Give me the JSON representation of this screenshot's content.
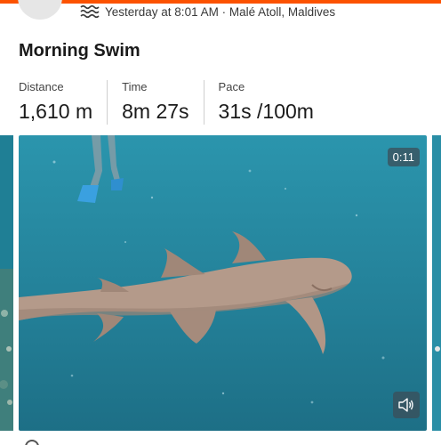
{
  "activity": {
    "meta": "Yesterday at 8:01 AM · Malé Atoll, Maldives",
    "title": "Morning Swim",
    "type_icon": "swim-icon"
  },
  "stats": [
    {
      "label": "Distance",
      "value": "1,610 m"
    },
    {
      "label": "Time",
      "value": "8m 27s"
    },
    {
      "label": "Pace",
      "value": "31s /100m"
    }
  ],
  "media": {
    "duration": "0:11",
    "sound_icon": "speaker-icon"
  },
  "colors": {
    "accent": "#fc5200",
    "water": "#2a8ea6"
  }
}
